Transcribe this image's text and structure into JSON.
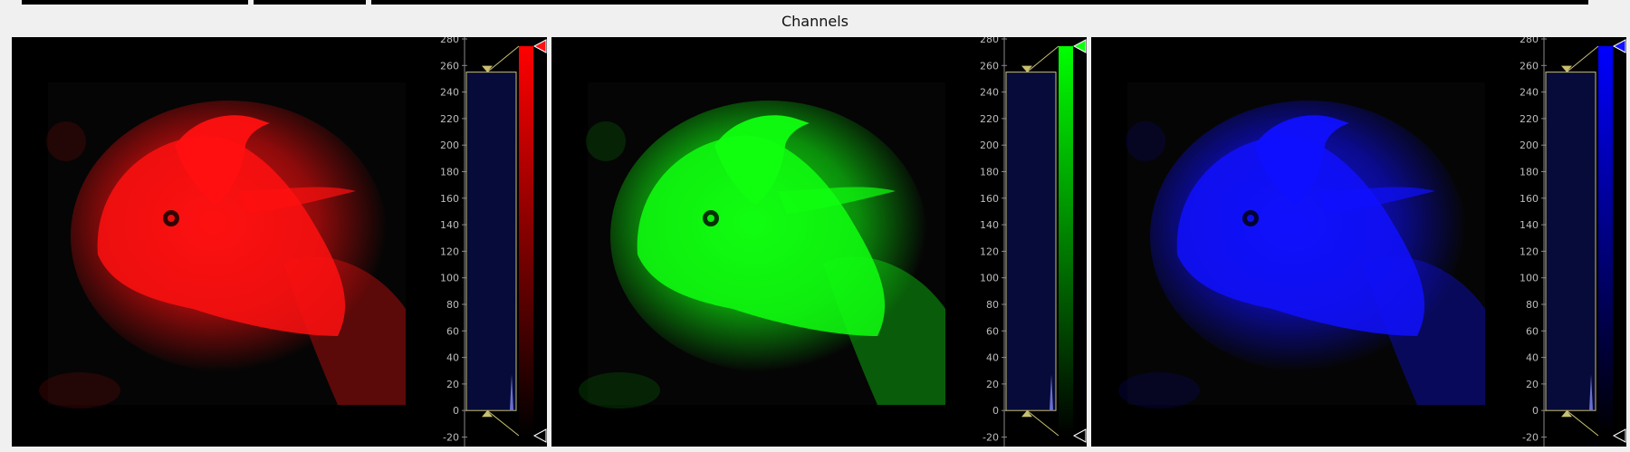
{
  "window": {
    "title": "Channels"
  },
  "axis_ticks": [
    "280",
    "260",
    "240",
    "220",
    "200",
    "180",
    "160",
    "140",
    "120",
    "100",
    "80",
    "60",
    "40",
    "20",
    "0",
    "-20"
  ],
  "channels": [
    {
      "id": "red",
      "accent": "#ff1010",
      "bar_top": "#ff0000",
      "histogram_fill": "#070b3a",
      "thumbnail": "eagle-red-image"
    },
    {
      "id": "green",
      "accent": "#10ff10",
      "bar_top": "#00ff00",
      "histogram_fill": "#070b3a",
      "thumbnail": "eagle-green-image"
    },
    {
      "id": "blue",
      "accent": "#1010ff",
      "bar_top": "#0000ff",
      "histogram_fill": "#070b3a",
      "thumbnail": "eagle-blue-image"
    }
  ]
}
